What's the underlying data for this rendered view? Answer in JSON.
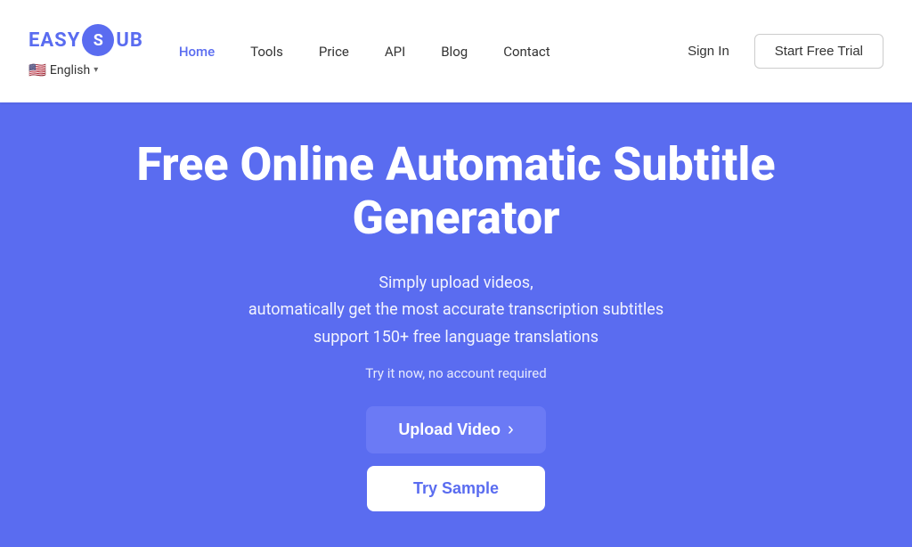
{
  "header": {
    "logo_text_easy": "EASY",
    "logo_letter": "S",
    "logo_text_sub": "UB",
    "lang": {
      "flag": "🇺🇸",
      "label": "English",
      "chevron": "▾"
    },
    "nav": [
      {
        "id": "home",
        "label": "Home",
        "active": true
      },
      {
        "id": "tools",
        "label": "Tools",
        "active": false
      },
      {
        "id": "price",
        "label": "Price",
        "active": false
      },
      {
        "id": "api",
        "label": "API",
        "active": false
      },
      {
        "id": "blog",
        "label": "Blog",
        "active": false
      },
      {
        "id": "contact",
        "label": "Contact",
        "active": false
      }
    ],
    "signin_label": "Sign In",
    "trial_label": "Start Free Trial"
  },
  "hero": {
    "title": "Free Online Automatic Subtitle Generator",
    "subtitle_line1": "Simply upload videos,",
    "subtitle_line2": "automatically get the most accurate transcription subtitles",
    "subtitle_line3": "support 150+ free language translations",
    "note": "Try it now, no account required",
    "upload_btn": "Upload Video",
    "upload_chevron": "›",
    "sample_btn": "Try Sample"
  },
  "colors": {
    "brand_blue": "#5a6cf0",
    "hero_bg": "#5a6cf0",
    "white": "#ffffff"
  }
}
